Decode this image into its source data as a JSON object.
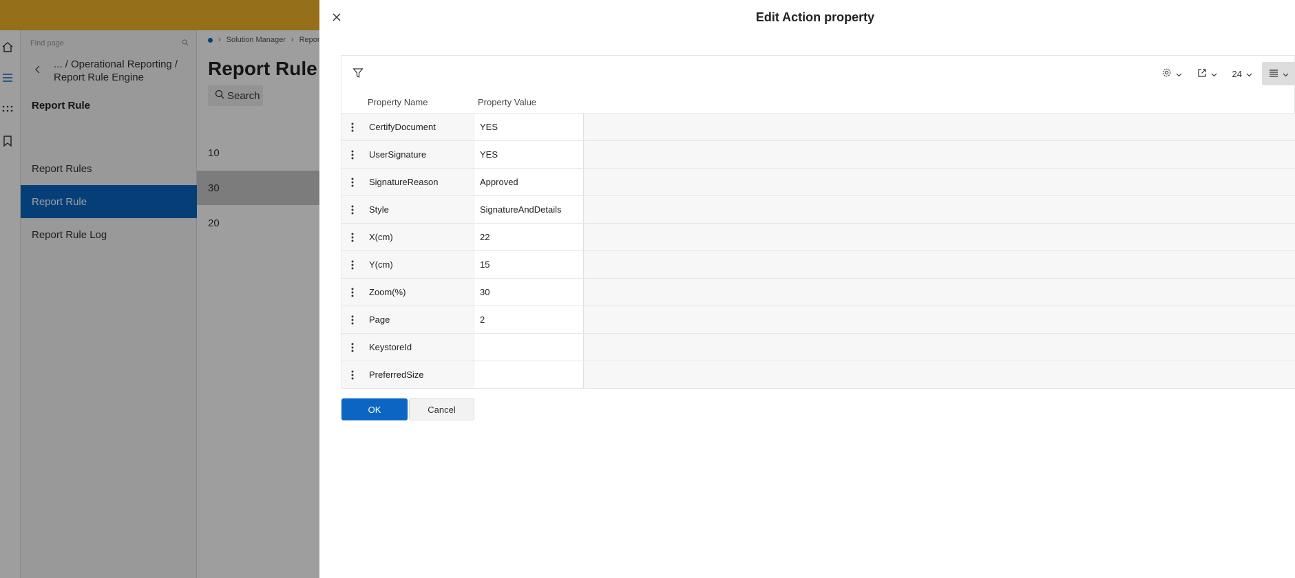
{
  "colors": {
    "topbar": "#f0b429",
    "accent": "#0a66c2"
  },
  "background": {
    "find_page_placeholder": "Find page",
    "nav_path": "... / Operational Reporting / Report Rule Engine",
    "nav_heading": "Report Rule",
    "nav_items": [
      {
        "label": "Report Rules",
        "active": false
      },
      {
        "label": "Report Rule",
        "active": true
      },
      {
        "label": "Report Rule Log",
        "active": false
      }
    ],
    "breadcrumb": [
      "Solution Manager",
      "Report"
    ],
    "main_title": "Report Rule",
    "search_label": "Search",
    "rows": [
      "10",
      "30",
      "20"
    ]
  },
  "dialog": {
    "title": "Edit Action property",
    "toolbar": {
      "page_size": "24",
      "icons": [
        "filter-icon",
        "gear-icon",
        "export-icon",
        "density-icon"
      ]
    },
    "columns": [
      "Property Name",
      "Property Value"
    ],
    "rows": [
      {
        "name": "CertifyDocument",
        "value": "YES"
      },
      {
        "name": "UserSignature",
        "value": "YES"
      },
      {
        "name": "SignatureReason",
        "value": "Approved"
      },
      {
        "name": "Style",
        "value": "SignatureAndDetails"
      },
      {
        "name": "X(cm)",
        "value": "22"
      },
      {
        "name": "Y(cm)",
        "value": "15"
      },
      {
        "name": "Zoom(%)",
        "value": "30"
      },
      {
        "name": "Page",
        "value": "2"
      },
      {
        "name": "KeystoreId",
        "value": ""
      },
      {
        "name": "PreferredSize",
        "value": ""
      }
    ],
    "ok_label": "OK",
    "cancel_label": "Cancel"
  }
}
